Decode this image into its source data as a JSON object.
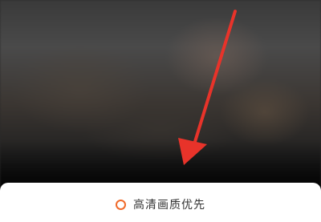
{
  "video": {
    "background_icon": "blurred-video-frame"
  },
  "annotation": {
    "arrow_color": "#e8332a",
    "icon": "red-arrow-icon"
  },
  "quality_sheet": {
    "option_label": "高清画质优先",
    "radio_color": "#f06a2a",
    "radio_selected": false
  }
}
